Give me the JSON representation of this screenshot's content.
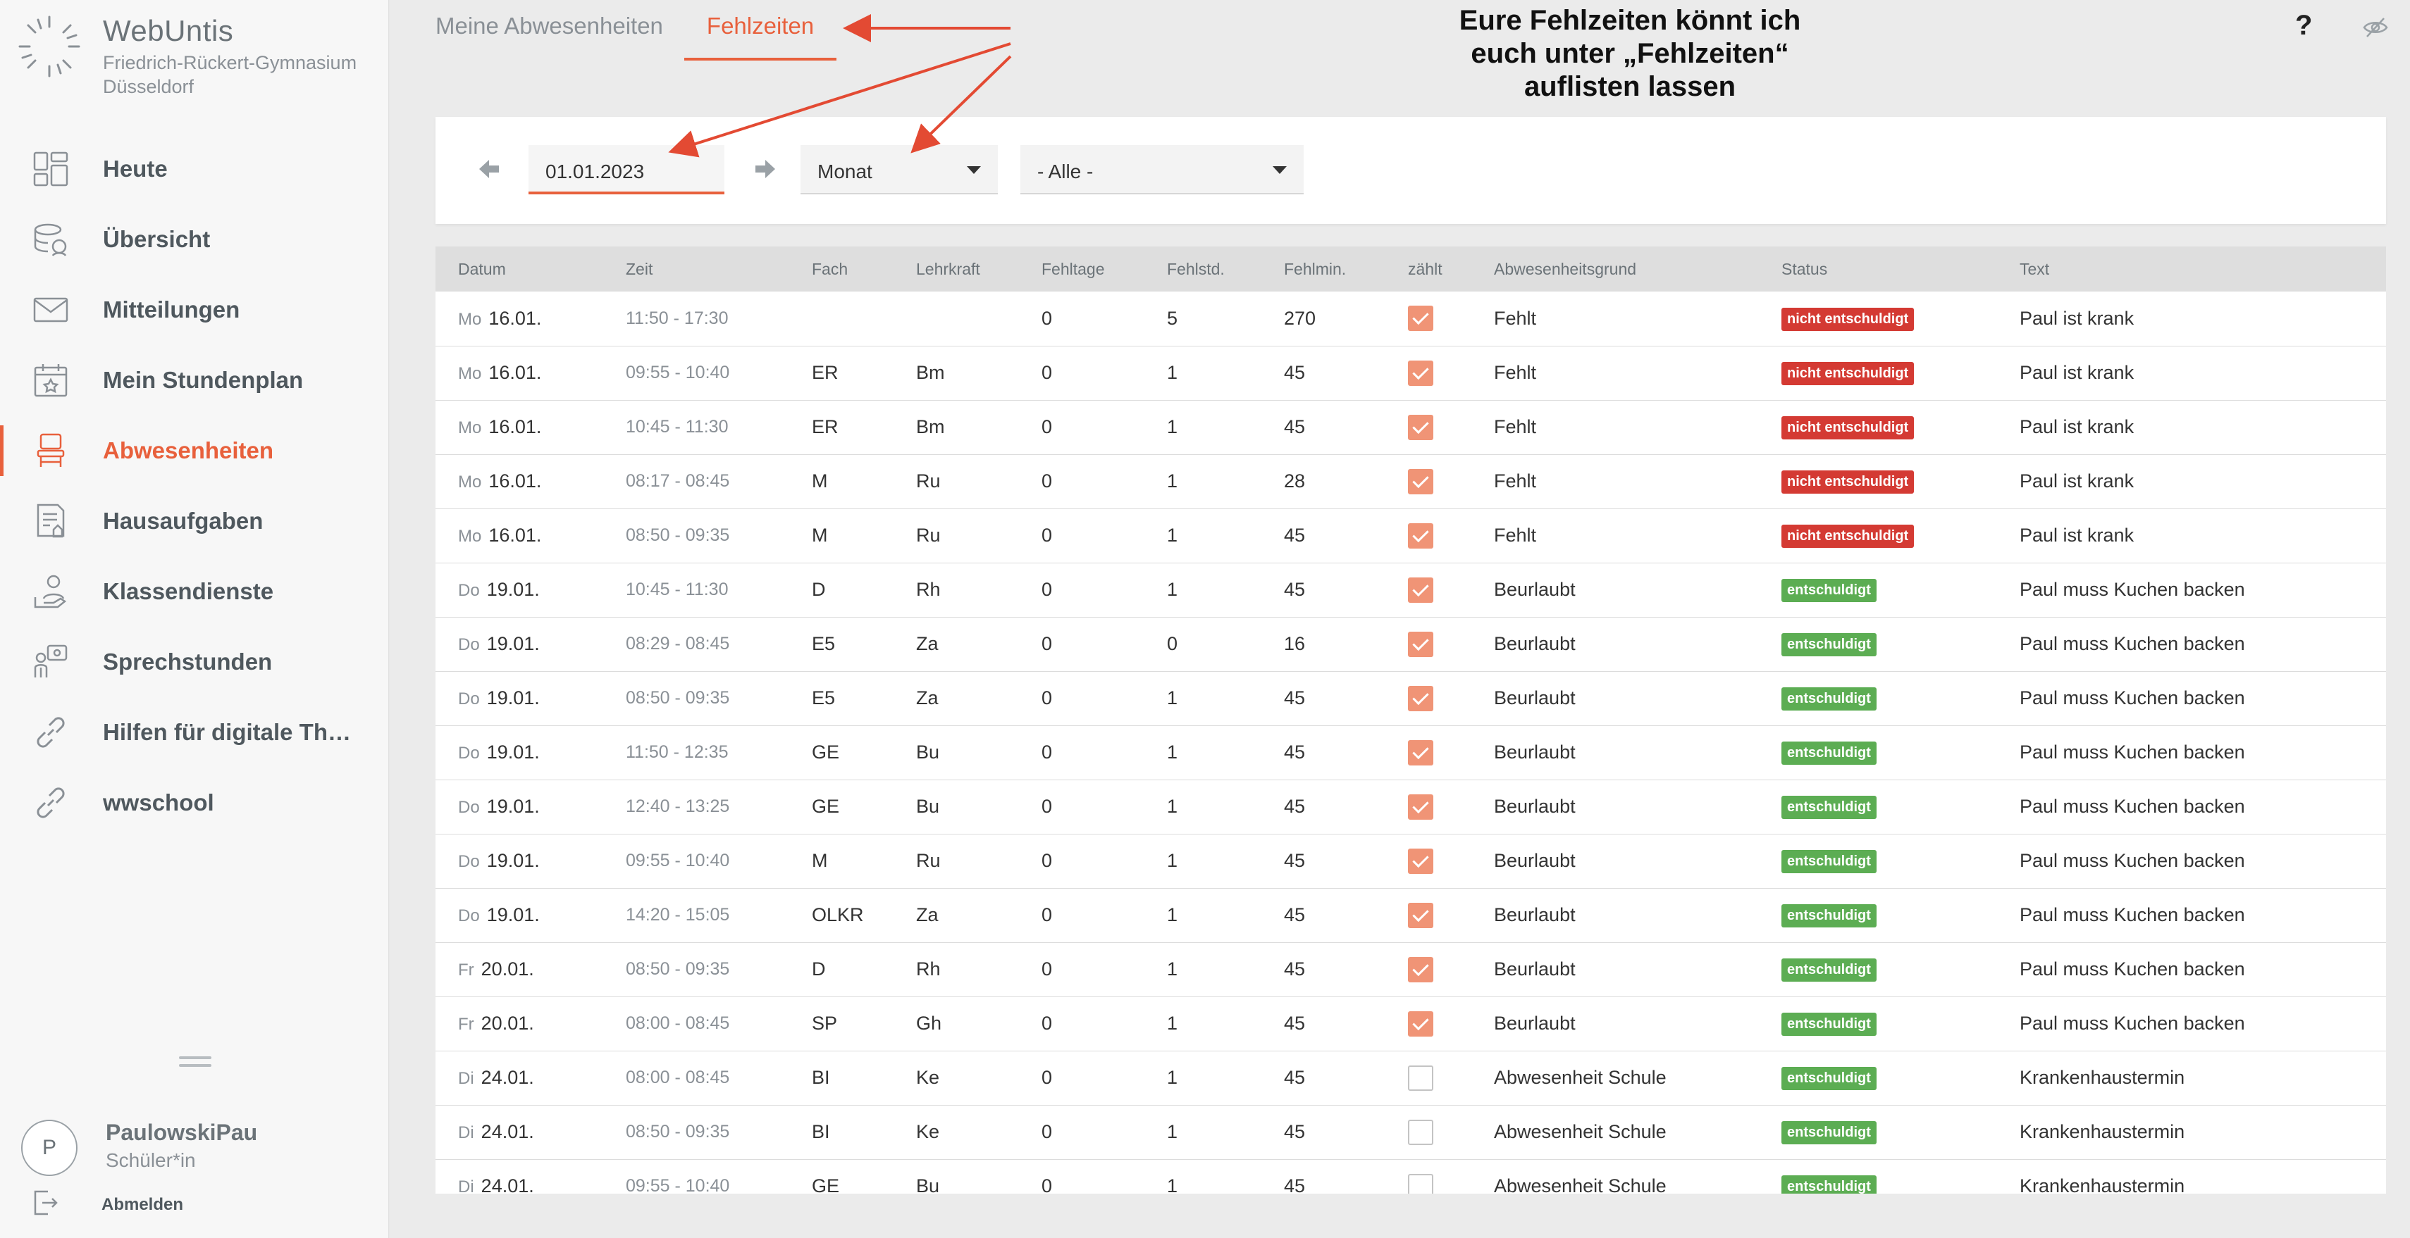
{
  "app": {
    "title": "WebUntis",
    "school_line1": "Friedrich-Rückert-Gymnasium",
    "school_line2": "Düsseldorf"
  },
  "sidebar": {
    "items": [
      {
        "label": "Heute",
        "icon": "dashboard-icon"
      },
      {
        "label": "Übersicht",
        "icon": "overview-icon"
      },
      {
        "label": "Mitteilungen",
        "icon": "mail-icon"
      },
      {
        "label": "Mein Stundenplan",
        "icon": "calendar-icon"
      },
      {
        "label": "Abwesenheiten",
        "icon": "chair-icon",
        "active": true
      },
      {
        "label": "Hausaufgaben",
        "icon": "homework-icon"
      },
      {
        "label": "Klassendienste",
        "icon": "class-duty-icon"
      },
      {
        "label": "Sprechstunden",
        "icon": "consultation-icon"
      },
      {
        "label": "Hilfen für digitale The…",
        "icon": "link-icon"
      },
      {
        "label": "wwschool",
        "icon": "link-icon"
      }
    ]
  },
  "user": {
    "initial": "P",
    "name": "PaulowskiPau",
    "role": "Schüler*in",
    "logout_label": "Abmelden"
  },
  "tabs": [
    {
      "label": "Meine Abwesenheiten",
      "active": false
    },
    {
      "label": "Fehlzeiten",
      "active": true
    }
  ],
  "annotation": {
    "line1": "Eure Fehlzeiten könnt ich",
    "line2": "euch unter „Fehlzeiten“",
    "line3": "auflisten lassen",
    "arrow_color": "#e34a33"
  },
  "filter": {
    "date_value": "01.01.2023",
    "period_value": "Monat",
    "filter_value": "- Alle -"
  },
  "help_label": "?",
  "table": {
    "headers": [
      "Datum",
      "Zeit",
      "Fach",
      "Lehrkraft",
      "Fehltage",
      "Fehlstd.",
      "Fehlmin.",
      "zählt",
      "Abwesenheitsgrund",
      "Status",
      "Text"
    ],
    "rows": [
      {
        "wd": "Mo",
        "date": "16.01.",
        "time": "11:50 - 17:30",
        "subject": "",
        "teacher": "",
        "days": "0",
        "hours": "5",
        "minutes": "270",
        "counts": true,
        "reason": "Fehlt",
        "status": "nicht entschuldigt",
        "status_type": "red",
        "text": "Paul ist krank"
      },
      {
        "wd": "Mo",
        "date": "16.01.",
        "time": "09:55 - 10:40",
        "subject": "ER",
        "teacher": "Bm",
        "days": "0",
        "hours": "1",
        "minutes": "45",
        "counts": true,
        "reason": "Fehlt",
        "status": "nicht entschuldigt",
        "status_type": "red",
        "text": "Paul ist krank"
      },
      {
        "wd": "Mo",
        "date": "16.01.",
        "time": "10:45 - 11:30",
        "subject": "ER",
        "teacher": "Bm",
        "days": "0",
        "hours": "1",
        "minutes": "45",
        "counts": true,
        "reason": "Fehlt",
        "status": "nicht entschuldigt",
        "status_type": "red",
        "text": "Paul ist krank"
      },
      {
        "wd": "Mo",
        "date": "16.01.",
        "time": "08:17 - 08:45",
        "subject": "M",
        "teacher": "Ru",
        "days": "0",
        "hours": "1",
        "minutes": "28",
        "counts": true,
        "reason": "Fehlt",
        "status": "nicht entschuldigt",
        "status_type": "red",
        "text": "Paul ist krank"
      },
      {
        "wd": "Mo",
        "date": "16.01.",
        "time": "08:50 - 09:35",
        "subject": "M",
        "teacher": "Ru",
        "days": "0",
        "hours": "1",
        "minutes": "45",
        "counts": true,
        "reason": "Fehlt",
        "status": "nicht entschuldigt",
        "status_type": "red",
        "text": "Paul ist krank"
      },
      {
        "wd": "Do",
        "date": "19.01.",
        "time": "10:45 - 11:30",
        "subject": "D",
        "teacher": "Rh",
        "days": "0",
        "hours": "1",
        "minutes": "45",
        "counts": true,
        "reason": "Beurlaubt",
        "status": "entschuldigt",
        "status_type": "green",
        "text": "Paul muss Kuchen backen"
      },
      {
        "wd": "Do",
        "date": "19.01.",
        "time": "08:29 - 08:45",
        "subject": "E5",
        "teacher": "Za",
        "days": "0",
        "hours": "0",
        "minutes": "16",
        "counts": true,
        "reason": "Beurlaubt",
        "status": "entschuldigt",
        "status_type": "green",
        "text": "Paul muss Kuchen backen"
      },
      {
        "wd": "Do",
        "date": "19.01.",
        "time": "08:50 - 09:35",
        "subject": "E5",
        "teacher": "Za",
        "days": "0",
        "hours": "1",
        "minutes": "45",
        "counts": true,
        "reason": "Beurlaubt",
        "status": "entschuldigt",
        "status_type": "green",
        "text": "Paul muss Kuchen backen"
      },
      {
        "wd": "Do",
        "date": "19.01.",
        "time": "11:50 - 12:35",
        "subject": "GE",
        "teacher": "Bu",
        "days": "0",
        "hours": "1",
        "minutes": "45",
        "counts": true,
        "reason": "Beurlaubt",
        "status": "entschuldigt",
        "status_type": "green",
        "text": "Paul muss Kuchen backen"
      },
      {
        "wd": "Do",
        "date": "19.01.",
        "time": "12:40 - 13:25",
        "subject": "GE",
        "teacher": "Bu",
        "days": "0",
        "hours": "1",
        "minutes": "45",
        "counts": true,
        "reason": "Beurlaubt",
        "status": "entschuldigt",
        "status_type": "green",
        "text": "Paul muss Kuchen backen"
      },
      {
        "wd": "Do",
        "date": "19.01.",
        "time": "09:55 - 10:40",
        "subject": "M",
        "teacher": "Ru",
        "days": "0",
        "hours": "1",
        "minutes": "45",
        "counts": true,
        "reason": "Beurlaubt",
        "status": "entschuldigt",
        "status_type": "green",
        "text": "Paul muss Kuchen backen"
      },
      {
        "wd": "Do",
        "date": "19.01.",
        "time": "14:20 - 15:05",
        "subject": "OLKR",
        "teacher": "Za",
        "days": "0",
        "hours": "1",
        "minutes": "45",
        "counts": true,
        "reason": "Beurlaubt",
        "status": "entschuldigt",
        "status_type": "green",
        "text": "Paul muss Kuchen backen"
      },
      {
        "wd": "Fr",
        "date": "20.01.",
        "time": "08:50 - 09:35",
        "subject": "D",
        "teacher": "Rh",
        "days": "0",
        "hours": "1",
        "minutes": "45",
        "counts": true,
        "reason": "Beurlaubt",
        "status": "entschuldigt",
        "status_type": "green",
        "text": "Paul muss Kuchen backen"
      },
      {
        "wd": "Fr",
        "date": "20.01.",
        "time": "08:00 - 08:45",
        "subject": "SP",
        "teacher": "Gh",
        "days": "0",
        "hours": "1",
        "minutes": "45",
        "counts": true,
        "reason": "Beurlaubt",
        "status": "entschuldigt",
        "status_type": "green",
        "text": "Paul muss Kuchen backen"
      },
      {
        "wd": "Di",
        "date": "24.01.",
        "time": "08:00 - 08:45",
        "subject": "BI",
        "teacher": "Ke",
        "days": "0",
        "hours": "1",
        "minutes": "45",
        "counts": false,
        "reason": "Abwesenheit Schule",
        "status": "entschuldigt",
        "status_type": "green",
        "text": "Krankenhaustermin"
      },
      {
        "wd": "Di",
        "date": "24.01.",
        "time": "08:50 - 09:35",
        "subject": "BI",
        "teacher": "Ke",
        "days": "0",
        "hours": "1",
        "minutes": "45",
        "counts": false,
        "reason": "Abwesenheit Schule",
        "status": "entschuldigt",
        "status_type": "green",
        "text": "Krankenhaustermin"
      },
      {
        "wd": "Di",
        "date": "24.01.",
        "time": "09:55 - 10:40",
        "subject": "GE",
        "teacher": "Bu",
        "days": "0",
        "hours": "1",
        "minutes": "45",
        "counts": false,
        "reason": "Abwesenheit Schule",
        "status": "entschuldigt",
        "status_type": "green",
        "text": "Krankenhaustermin"
      }
    ]
  }
}
